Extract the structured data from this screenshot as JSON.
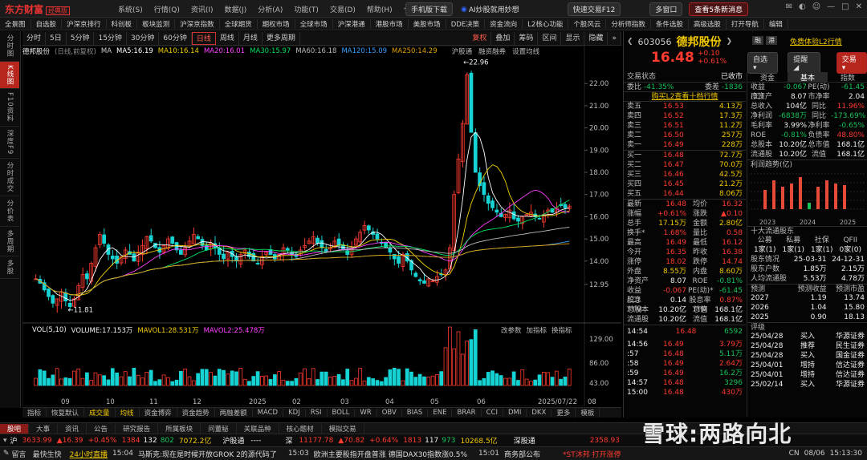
{
  "app": {
    "logo": "东方财富",
    "edition": "经典版",
    "menus": [
      "系统(S)",
      "行情(Q)",
      "资讯(I)",
      "数据(J)",
      "分析(A)",
      "功能(T)",
      "交易(D)",
      "帮助(H)",
      "个股分享"
    ],
    "mobile_btn": "手机版下载",
    "ai_btn": "AI炒股就用妙想",
    "quick_trade": "快速交易F12",
    "multi_window": "多窗口",
    "news_alert": "查看5条新消息"
  },
  "navbar": [
    "全景图",
    "自选股",
    "沪深京排行",
    "科创板",
    "板块监测",
    "沪深京指数",
    "全球期货",
    "期权市场",
    "全球市场",
    "沪深港通",
    "港股市场",
    "美股市场",
    "DDE决策",
    "资金流向",
    "L2核心功能",
    "个股风云",
    "分析师指数",
    "条件选股",
    "高级选股",
    "打开导航",
    "编辑"
  ],
  "chart_toolbar": {
    "periods": [
      "分时",
      "5日",
      "5分钟",
      "15分钟",
      "30分钟",
      "60分钟",
      "日线",
      "周线",
      "月线",
      "更多周期"
    ],
    "active": "日线",
    "tools": [
      "复权",
      "叠加",
      "筹码",
      "区间",
      "显示",
      "隐藏"
    ]
  },
  "leftbar": [
    "分时图",
    "K线图",
    "F10资料",
    "深度F9",
    "分时成交",
    "分价表",
    "多周期",
    "多股"
  ],
  "leftbar_active": "K线图",
  "ma_legend": {
    "name": "德邦股份",
    "mode": "(日线,前复权)",
    "items": [
      {
        "label": "MA",
        "color": "#cfcfcf"
      },
      {
        "label": "MA5:16.19",
        "color": "#ffffff"
      },
      {
        "label": "MA10:16.14",
        "color": "#f0d000"
      },
      {
        "label": "MA20:16.01",
        "color": "#ff40ff"
      },
      {
        "label": "MA30:15.97",
        "color": "#00e060"
      },
      {
        "label": "MA60:16.18",
        "color": "#bbbbbb"
      },
      {
        "label": "MA120:15.09",
        "color": "#37a0ff"
      },
      {
        "label": "MA250:14.29",
        "color": "#e0a000"
      }
    ],
    "tools": [
      "沪股通",
      "融资融券",
      "设置均线"
    ]
  },
  "vol_legend": {
    "vol": "VOL(5,10)",
    "volume": "VOLUME:17.153万",
    "mavol1": "MAVOL1:28.531万",
    "mavol2": "MAVOL2:25.478万",
    "right_tools": [
      "改参数",
      "加指标",
      "换指标"
    ]
  },
  "chart_data": {
    "type": "candlestick",
    "price_axis": [
      "22.00",
      "21.00",
      "20.00",
      "19.00",
      "18.00",
      "17.00",
      "16.00",
      "15.00",
      "14.00",
      "12.95"
    ],
    "ylim": [
      11.5,
      23.2
    ],
    "vol_axis": [
      "129.00",
      "86.00",
      "43.00"
    ],
    "x_labels": [
      "09",
      "10",
      "11",
      "12",
      "2025",
      "02",
      "03",
      "04",
      "05",
      "06",
      "2025/07/22",
      "08"
    ],
    "high_label": "22.96",
    "low_label": "11.81",
    "closes": [
      13.2,
      13.0,
      12.7,
      12.4,
      12.1,
      12.3,
      12.6,
      12.2,
      11.95,
      12.3,
      12.9,
      13.4,
      13.2,
      13.9,
      14.6,
      15.2,
      14.8,
      14.3,
      14.1,
      13.9,
      14.2,
      14.5,
      14.3,
      14.0,
      14.4,
      14.7,
      15.1,
      14.9,
      14.6,
      14.4,
      14.7,
      15.0,
      14.8,
      14.5,
      14.3,
      14.6,
      14.9,
      15.2,
      15.0,
      14.7,
      14.5,
      14.8,
      14.6,
      14.3,
      14.1,
      14.4,
      14.2,
      14.0,
      14.3,
      14.5,
      14.2,
      14.0,
      13.9,
      14.2,
      14.4,
      14.3,
      14.1,
      14.3,
      14.6,
      14.5,
      14.3,
      14.2,
      14.5,
      14.7,
      14.9,
      15.1,
      14.8,
      14.6,
      14.4,
      14.6,
      14.9,
      14.7,
      14.5,
      14.3,
      14.6,
      15.0,
      15.3,
      15.6,
      15.4,
      15.2,
      15.0,
      14.8,
      14.6,
      14.4,
      14.1,
      13.9,
      14.3,
      14.0,
      13.6,
      13.3,
      13.1,
      13.0,
      13.2,
      13.1,
      13.3,
      13.4,
      13.6,
      14.6,
      17.0,
      18.6,
      20.2,
      22.4,
      19.8,
      18.0,
      17.4,
      17.0,
      16.6,
      16.4,
      16.2,
      16.0,
      16.1,
      16.3,
      15.9,
      15.8,
      16.0,
      16.1,
      16.2,
      16.0,
      15.9,
      16.1,
      16.3,
      16.2,
      16.4,
      16.5,
      16.4,
      16.48
    ]
  },
  "right": {
    "code": "603056",
    "name": "德邦股份",
    "price": "16.48",
    "change": "+0.10",
    "change_pct": "+0.61%",
    "tags": [
      "融",
      "港"
    ],
    "l2_free": "免费体验L2行情",
    "btn_watch": "自选",
    "btn_alert": "提醒",
    "btn_trade": "交易",
    "status_label": "交易状态",
    "status_value": "已收市",
    "weibi_label": "委比",
    "weibi": "-41.35%",
    "weicha_label": "委差",
    "weicha": "-1836",
    "buy_l2": "购买L2查看十档行情",
    "asks": [
      {
        "label": "卖五",
        "price": "16.53",
        "vol": "4.13万"
      },
      {
        "label": "卖四",
        "price": "16.52",
        "vol": "17.3万"
      },
      {
        "label": "卖三",
        "price": "16.51",
        "vol": "11.2万"
      },
      {
        "label": "卖二",
        "price": "16.50",
        "vol": "257万"
      },
      {
        "label": "卖一",
        "price": "16.49",
        "vol": "228万"
      }
    ],
    "bids": [
      {
        "label": "买一",
        "price": "16.48",
        "vol": "72.7万"
      },
      {
        "label": "买二",
        "price": "16.47",
        "vol": "70.0万"
      },
      {
        "label": "买三",
        "price": "16.46",
        "vol": "42.5万"
      },
      {
        "label": "买四",
        "price": "16.45",
        "vol": "21.2万"
      },
      {
        "label": "买五",
        "price": "16.44",
        "vol": "8.06万"
      }
    ],
    "stats": [
      [
        "最新",
        "16.48",
        "均价",
        "16.32"
      ],
      [
        "涨幅",
        "+0.61%",
        "涨跌",
        "▲0.10"
      ],
      [
        "总手",
        "17.15万",
        "金额",
        "2.80亿"
      ],
      [
        "换手*",
        "1.68%",
        "量比",
        "0.58"
      ],
      [
        "最高",
        "16.49",
        "最低",
        "16.12"
      ],
      [
        "今开",
        "16.35",
        "昨收",
        "16.38"
      ],
      [
        "涨停",
        "18.02",
        "跌停",
        "14.74"
      ],
      [
        "外盘",
        "8.55万",
        "内盘",
        "8.60万"
      ],
      [
        "净资产",
        "8.07",
        "ROE",
        "-0.81%"
      ],
      [
        "收益(二)",
        "-0.067",
        "PE(动)*",
        "-61.45"
      ],
      [
        "股息TTM",
        "0.14",
        "股息率TTM",
        "0.87%"
      ],
      [
        "总股本",
        "10.20亿",
        "总值",
        "168.1亿"
      ],
      [
        "流通股",
        "10.20亿",
        "流值",
        "168.1亿"
      ]
    ],
    "ticks": [
      [
        "14:56",
        "16.49",
        "3.79万"
      ],
      [
        ":57",
        "16.48",
        "5.11万"
      ],
      [
        ":58",
        "16.49",
        "2.64万"
      ],
      [
        ":59",
        "16.49",
        "16.2万"
      ],
      [
        "14:57",
        "16.48",
        "3296"
      ],
      [
        "15:00",
        "16.48",
        "430万"
      ]
    ],
    "first_tick": [
      "14:54",
      "16.48",
      "6592"
    ],
    "fund_tabs": [
      "资金",
      "基本",
      "指数"
    ],
    "fund_active": "基本",
    "fund_rows": [
      [
        "收益(二)",
        "-0.067",
        "PE(动)",
        "-61.45"
      ],
      [
        "净资产",
        "8.07",
        "市净率",
        "2.04"
      ],
      [
        "总收入",
        "104亿",
        "同比",
        "11.96%"
      ],
      [
        "净利润",
        "-6838万",
        "同比",
        "-173.69%"
      ],
      [
        "毛利率",
        "3.99%",
        "净利率",
        "-0.65%"
      ],
      [
        "ROE",
        "-0.81%",
        "负债率",
        "48.80%"
      ],
      [
        "总股本",
        "10.20亿",
        "总市值",
        "168.1亿"
      ],
      [
        "流通股",
        "10.20亿",
        "流值",
        "168.1亿"
      ]
    ],
    "profit_title": "利润趋势(亿)",
    "profit_years": [
      "2023",
      "2024",
      "2025"
    ],
    "profit_bars": [
      0.6,
      0.9,
      0.7,
      0.8,
      1.0,
      0.2,
      0.7,
      0.9,
      0.8,
      0.75
    ],
    "holders_title": "十大流通股东",
    "holders_head": [
      "公募",
      "私募",
      "社保",
      "QFII"
    ],
    "holders_vals": [
      "1家(1)",
      "1家(1)",
      "1家(1)",
      "0家(0)"
    ],
    "holders_rows": [
      [
        "股东情况",
        "25-03-31",
        "24-12-31"
      ],
      [
        "股东户数",
        "1.85万",
        "2.15万"
      ],
      [
        "人均流通股",
        "5.53万",
        "4.78万"
      ]
    ],
    "forecast_head": [
      "预测",
      "预测收益",
      "预测市盈"
    ],
    "forecast_rows": [
      [
        "2027",
        "1.19",
        "13.74"
      ],
      [
        "2026",
        "1.04",
        "15.80"
      ],
      [
        "2025",
        "0.90",
        "18.13"
      ]
    ],
    "rating_head": [
      "评级"
    ],
    "ratings": [
      [
        "25/04/28",
        "买入",
        "华源证券"
      ],
      [
        "25/04/28",
        "推荐",
        "民生证券"
      ],
      [
        "25/04/28",
        "买入",
        "国金证券"
      ],
      [
        "25/04/01",
        "增持",
        "信达证券"
      ],
      [
        "25/04/01",
        "增持",
        "信达证券"
      ],
      [
        "25/02/14",
        "买入",
        "华源证券"
      ]
    ]
  },
  "ind_tabs": [
    "指标",
    "恢复默认",
    "成交量",
    "均线",
    "资金博弈",
    "资金趋势",
    "两融差额",
    "MACD",
    "KDJ",
    "RSI",
    "BOLL",
    "WR",
    "OBV",
    "BIAS",
    "ENE",
    "BRAR",
    "CCI",
    "DMI",
    "DKX",
    "更多",
    "模板"
  ],
  "bottom_tabs": [
    "股吧",
    "大事",
    "资讯",
    "公告",
    "研究报告",
    "所属板块",
    "问董秘",
    "关联品种",
    "核心题材",
    "模拟交易"
  ],
  "indexbar": {
    "sh": "沪",
    "sh_val": "3633.99",
    "sh_chg": "16.39",
    "sh_pct": "+0.45%",
    "sh_up": "1384",
    "sh_flat": "132",
    "sh_down": "802",
    "sh_amt": "7072.2亿",
    "hgt": "沪股通",
    "hgt_val": "----",
    "sz": "深",
    "sz_val": "11177.78",
    "sz_chg": "70.82",
    "sz_pct": "+0.64%",
    "sz_up": "1813",
    "sz_flat": "117",
    "sz_down": "973",
    "sz_amt": "10268.5亿",
    "sgt": "深股通",
    "sgt_val": "2358.93"
  },
  "newsbar": {
    "left": "留言",
    "left2": "最快生快",
    "hot": "24小时直播",
    "items": [
      {
        "time": "15:04",
        "text": "马斯克:现在是时候开放GROK 2的源代码了"
      },
      {
        "time": "15:03",
        "text": "欧洲主要股指开盘普涨 德国DAX30指数涨0.5%"
      },
      {
        "time": "15:01",
        "text": "商务部公布"
      }
    ],
    "st": "*ST沐邦 打开涨停",
    "cn": "CN",
    "date": "08/06",
    "clock": "15:13:30"
  },
  "watermark": "雪球:两路向北"
}
